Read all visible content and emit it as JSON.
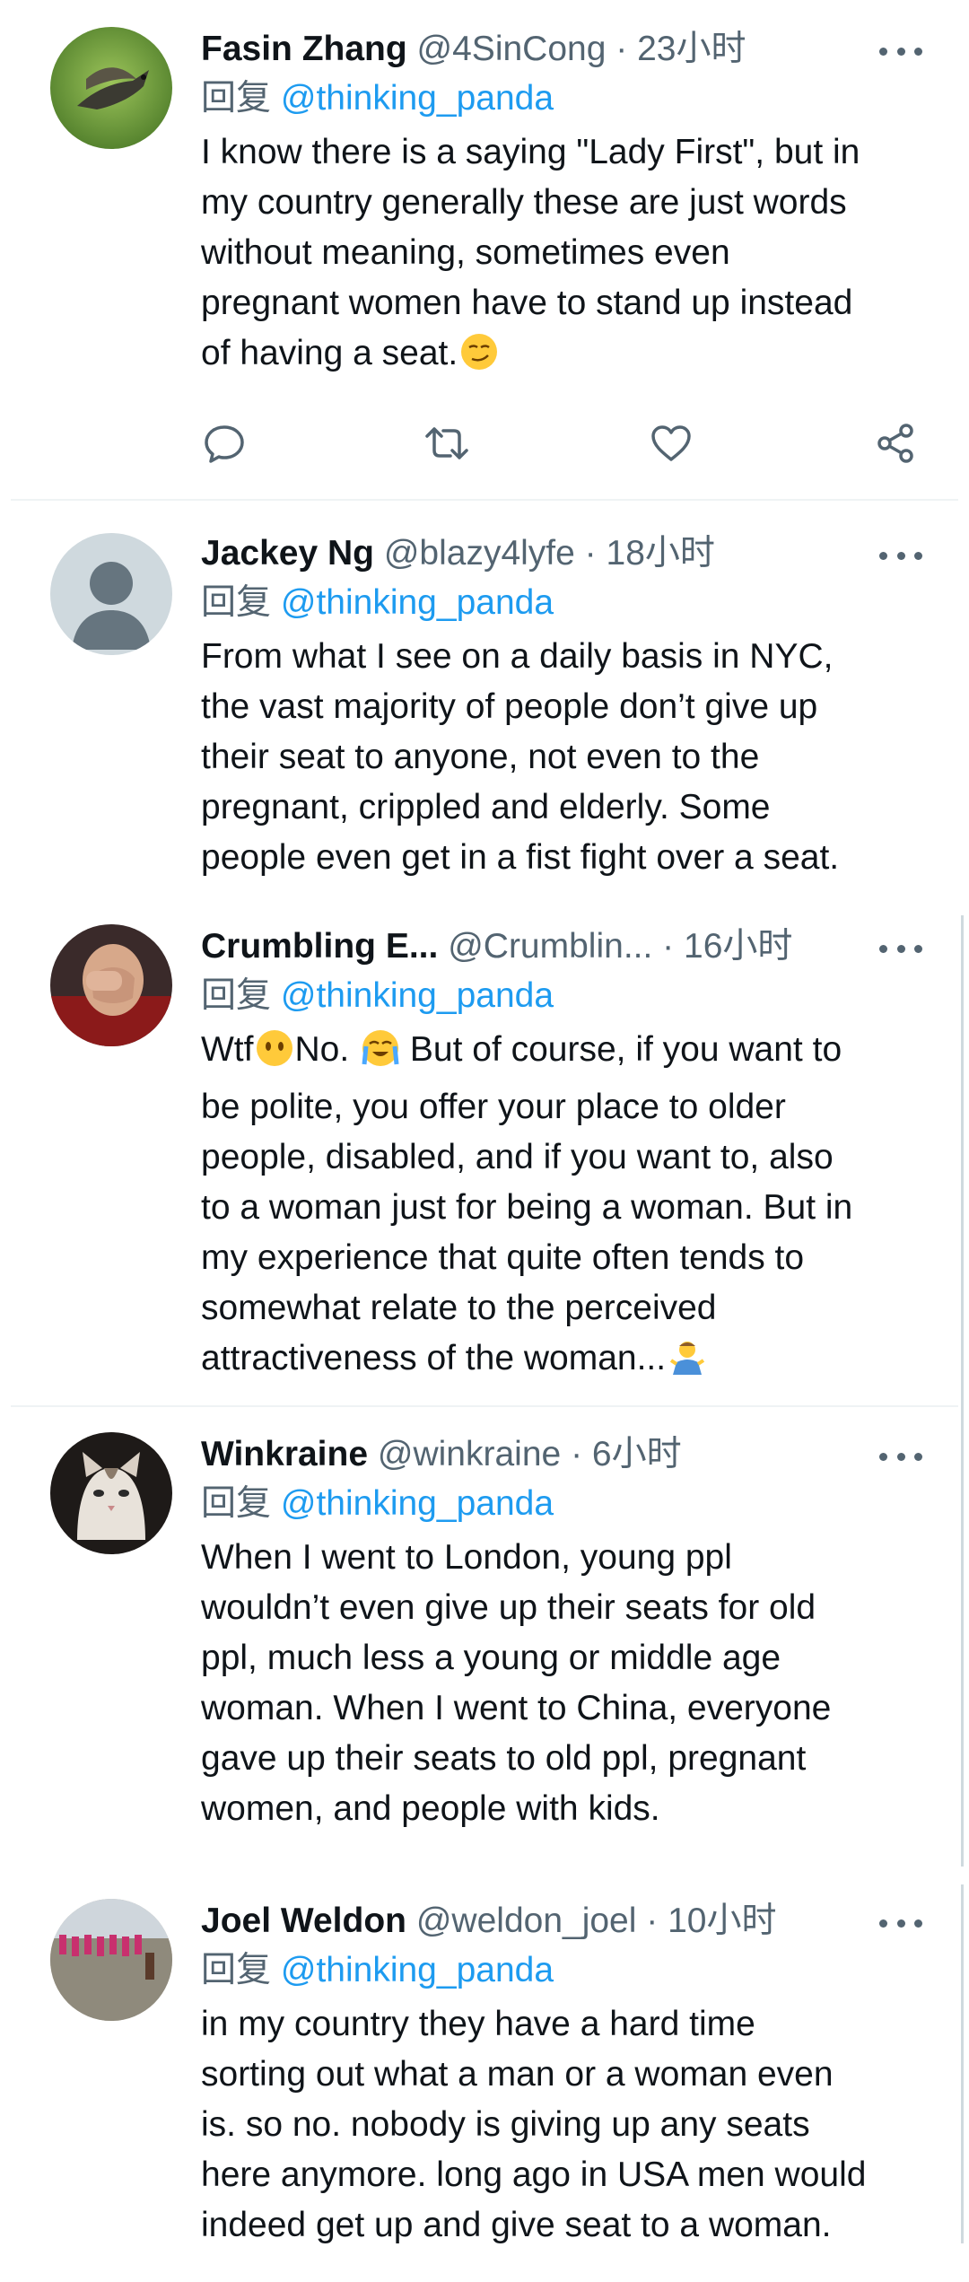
{
  "reply_prefix": "回复",
  "actions": {
    "reply_icon": "comment-bubble-icon",
    "retweet_icon": "retweet-icon",
    "like_icon": "heart-icon",
    "share_icon": "share-icon"
  },
  "colors": {
    "link": "#1d9bf0",
    "meta": "#536471",
    "text": "#0f1419"
  },
  "tweets": [
    {
      "name": "Fasin Zhang",
      "handle": "@4SinCong",
      "time": "23小时",
      "reply_to": "@thinking_panda",
      "text": "I know there is a saying \"Lady First\", but in\nmy country generally these are just words\nwithout meaning, sometimes even\npregnant women have to stand up instead\nof having a seat.",
      "emoji": "smirk-face",
      "avatar": "bird-photo"
    },
    {
      "name": "Jackey Ng",
      "handle": "@blazy4lyfe",
      "time": "18小时",
      "reply_to": "@thinking_panda",
      "text": "From what I see on a daily basis in NYC,\nthe vast majority of people don’t give up\ntheir seat to anyone, not even to the\npregnant, crippled and elderly. Some\npeople even get in a fist fight over a seat.",
      "avatar": "default-avatar"
    },
    {
      "name": "Crumbling E...",
      "handle": "@Crumblin...",
      "time": "16小时",
      "reply_to": "@thinking_panda",
      "text_parts": [
        "Wtf",
        "No.",
        "But of course, if you want to"
      ],
      "text": "be polite, you offer your place to older\npeople, disabled, and if you want to, also\nto a woman just for being a woman. But in\nmy experience that quite often tends to\nsomewhat relate to the perceived\nattractiveness of the woman...",
      "emojis": [
        "face-without-mouth",
        "loudly-crying-face",
        "man-shrugging"
      ],
      "avatar": "facepalm-photo"
    },
    {
      "name": "Winkraine",
      "handle": "@winkraine",
      "time": "6小时",
      "reply_to": "@thinking_panda",
      "text": "When I went to London, young ppl\nwouldn’t even give up their seats for old\nppl, much less a young or middle age\nwoman. When I went to China, everyone\ngave up their seats to old ppl, pregnant\nwomen, and people with kids.",
      "avatar": "cat-photo"
    },
    {
      "name": "Joel Weldon",
      "handle": "@weldon_joel",
      "time": "10小时",
      "reply_to": "@thinking_panda",
      "text": "in my country they have a hard time\nsorting out what a man or a woman even\nis. so no. nobody is giving up any seats\nhere anymore. long ago in USA men would\nindeed get up and give seat to a woman.",
      "avatar": "crowd-photo"
    }
  ]
}
